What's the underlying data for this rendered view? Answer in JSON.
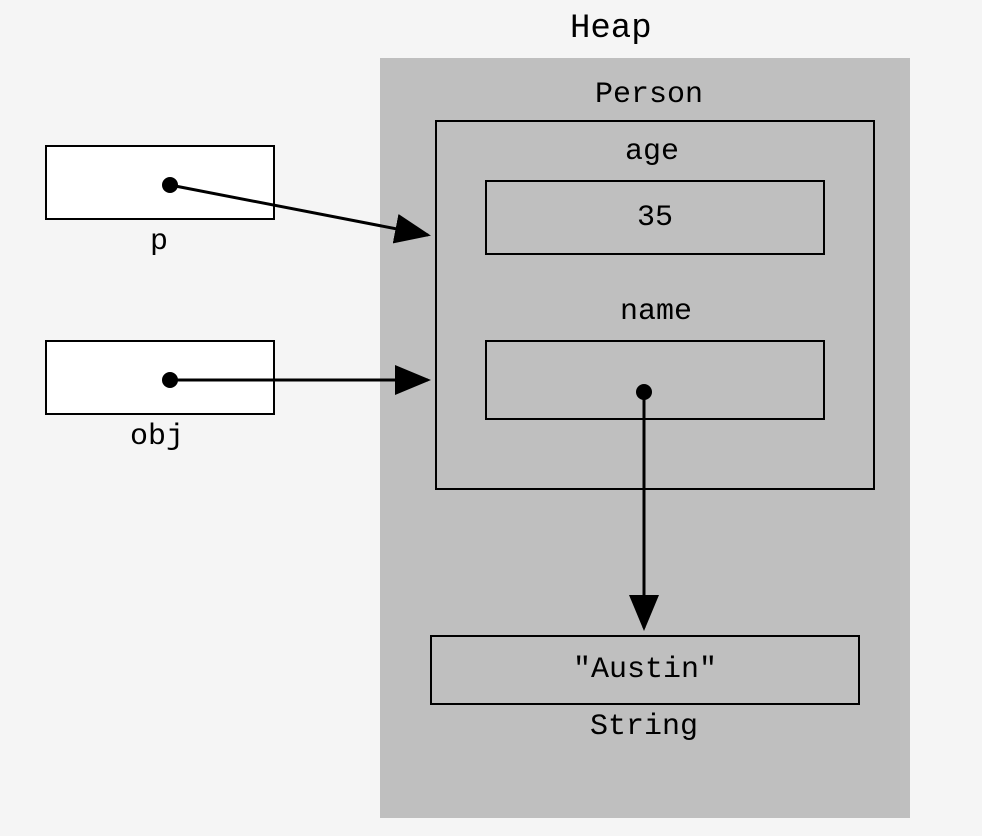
{
  "heap": {
    "title": "Heap",
    "person": {
      "className": "Person",
      "fields": {
        "age": {
          "label": "age",
          "value": "35"
        },
        "name": {
          "label": "name"
        }
      }
    },
    "string": {
      "className": "String",
      "value": "\"Austin\""
    }
  },
  "references": {
    "p": {
      "label": "p"
    },
    "obj": {
      "label": "obj"
    }
  }
}
